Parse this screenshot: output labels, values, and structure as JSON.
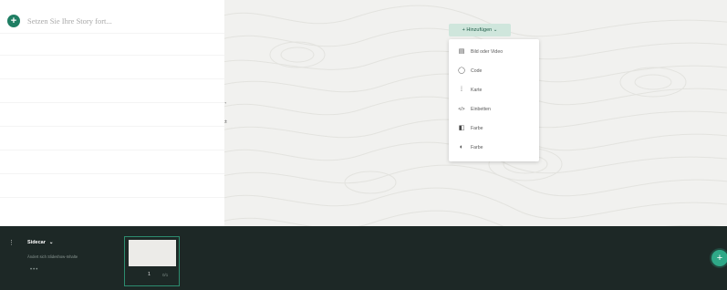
{
  "editor": {
    "title_placeholder": "Setzen Sie Ihre Story fort..."
  },
  "canvas": {
    "tool_one_icon": "arrow-right-icon",
    "tool_one_glyph": "→",
    "tool_two_icon": "swap-icon",
    "tool_two_glyph": "⇄"
  },
  "add_menu": {
    "button_label": "+ Hinzufügen  ⌄",
    "items": [
      {
        "label": "Bild oder Video",
        "icon": "image-icon",
        "glyph": "▤"
      },
      {
        "label": "Code",
        "icon": "code-icon",
        "glyph": "◯"
      },
      {
        "label": "Karte",
        "icon": "map-pin-icon",
        "glyph": "⁞"
      },
      {
        "label": "Einbetten",
        "icon": "embed-icon",
        "glyph": "</>"
      },
      {
        "label": "Farbe",
        "icon": "fill-icon",
        "glyph": "◧"
      },
      {
        "label": "Farbe",
        "icon": "color-icon",
        "glyph": "◐"
      }
    ]
  },
  "bottom_bar": {
    "menu_glyph": "⋮",
    "slide_title": "Sidecar",
    "slide_chevron": "⌄",
    "slide_hint": "Ändert sich Slideshow-Inhalte",
    "dots": "•••",
    "thumb_number": "1",
    "thumb_extra": "0/1",
    "fab_glyph": "+"
  },
  "colors": {
    "accent": "#1f7e63",
    "bottom_bg": "#1d2826",
    "fab": "#2fa887"
  }
}
